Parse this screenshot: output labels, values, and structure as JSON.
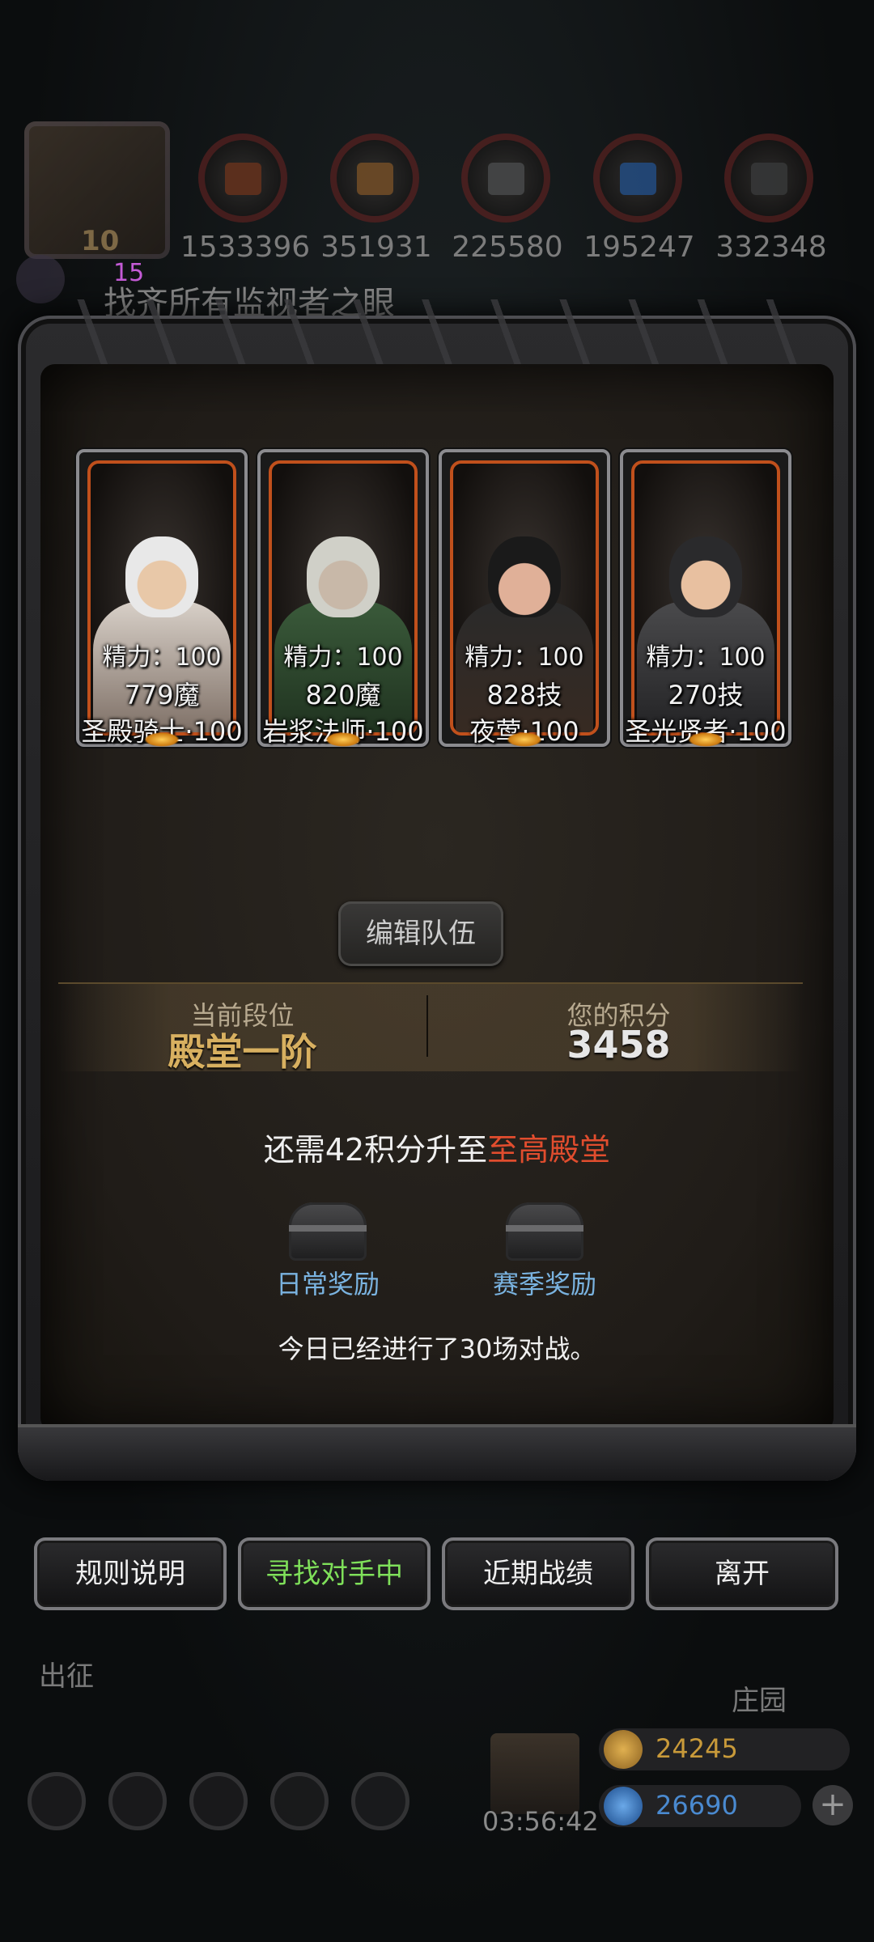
{
  "resources": {
    "chest_level": "10",
    "items": [
      {
        "icon": "meat-icon",
        "value": "1533396"
      },
      {
        "icon": "wood-icon",
        "value": "351931"
      },
      {
        "icon": "iron-icon",
        "value": "225580"
      },
      {
        "icon": "crystal-icon",
        "value": "195247"
      },
      {
        "icon": "stone-icon",
        "value": "332348"
      }
    ]
  },
  "quest": {
    "count": "15",
    "text": "找齐所有监视者之眼"
  },
  "heroes": [
    {
      "energy": "精力：100",
      "power": "779魔",
      "name": "圣殿骑士·100"
    },
    {
      "energy": "精力：100",
      "power": "820魔",
      "name": "岩浆法师·100"
    },
    {
      "energy": "精力：100",
      "power": "828技",
      "name": "夜莺·100"
    },
    {
      "energy": "精力：100",
      "power": "270技",
      "name": "圣光贤者·100"
    }
  ],
  "edit_team_label": "编辑队伍",
  "rank": {
    "current_label": "当前段位",
    "current_value": "殿堂一阶",
    "score_label": "您的积分",
    "score_value": "3458"
  },
  "promotion": {
    "prefix": "还需42积分升至",
    "target": "至高殿堂"
  },
  "rewards": {
    "daily": "日常奖励",
    "season": "赛季奖励"
  },
  "battle_count_text": "今日已经进行了30场对战。",
  "buttons": {
    "rules": "规则说明",
    "searching": "寻找对手中",
    "records": "近期战绩",
    "leave": "离开"
  },
  "hud": {
    "deploy_label": "出征",
    "manor_label": "庄园",
    "timer": "03:56:42",
    "gold": "24245",
    "gems": "26690"
  },
  "colors": {
    "accent_gold": "#d8b060",
    "highlight_red": "#e14d2e",
    "searching_green": "#7fe05a",
    "reward_blue": "#7ab3e0",
    "card_border_orange": "#c0501c"
  }
}
